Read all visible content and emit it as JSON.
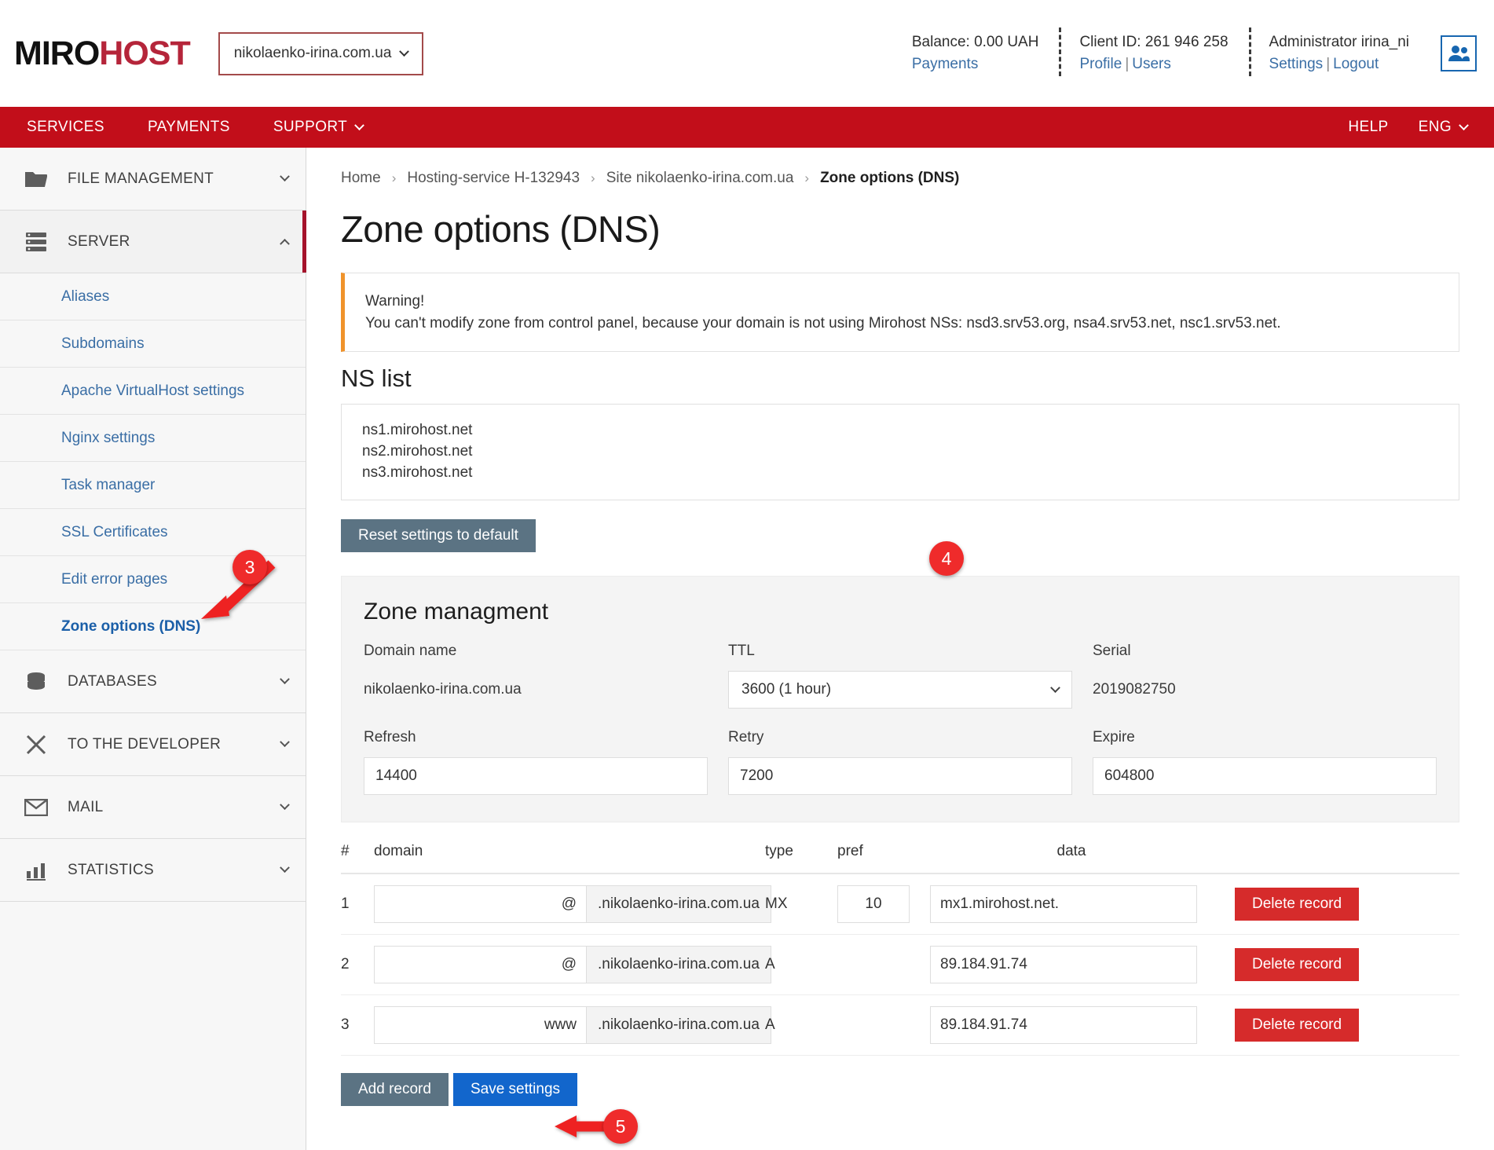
{
  "header": {
    "logo_part1": "MIRO",
    "logo_part2": "HOST",
    "domain_selector": "nikolaenko-irina.com.ua",
    "balance": "Balance: 0.00 UAH",
    "payments_link": "Payments",
    "client_id": "Client ID: 261 946 258",
    "profile_link": "Profile",
    "users_link": "Users",
    "administrator": "Administrator irina_ni",
    "settings_link": "Settings",
    "logout_link": "Logout",
    "separator": "|"
  },
  "nav": {
    "services": "SERVICES",
    "payments": "PAYMENTS",
    "support": "SUPPORT",
    "help": "HELP",
    "lang": "ENG"
  },
  "sidebar": {
    "sections": [
      {
        "label": "FILE MANAGEMENT",
        "icon": "folder-icon",
        "expanded": false
      },
      {
        "label": "SERVER",
        "icon": "server-icon",
        "expanded": true
      },
      {
        "label": "DATABASES",
        "icon": "database-icon",
        "expanded": false
      },
      {
        "label": "TO THE DEVELOPER",
        "icon": "tools-icon",
        "expanded": false
      },
      {
        "label": "MAIL",
        "icon": "envelope-icon",
        "expanded": false
      },
      {
        "label": "STATISTICS",
        "icon": "chart-icon",
        "expanded": false
      }
    ],
    "server_items": [
      "Aliases",
      "Subdomains",
      "Apache VirtualHost settings",
      "Nginx settings",
      "Task manager",
      "SSL Certificates",
      "Edit error pages",
      "Zone options (DNS)"
    ]
  },
  "breadcrumb": {
    "items": [
      "Home",
      "Hosting-service H-132943",
      "Site nikolaenko-irina.com.ua",
      "Zone options (DNS)"
    ],
    "separator": "›"
  },
  "page": {
    "title": "Zone options (DNS)",
    "warning_title": "Warning!",
    "warning_text": "You can't modify zone from control panel, because your domain is not using Mirohost NSs: nsd3.srv53.org, nsa4.srv53.net, nsc1.srv53.net.",
    "ns_list_heading": "NS list",
    "ns_list": [
      "ns1.mirohost.net",
      "ns2.mirohost.net",
      "ns3.mirohost.net"
    ],
    "reset_button": "Reset settings to default"
  },
  "zone": {
    "title": "Zone managment",
    "domain_name_label": "Domain name",
    "domain_name_value": "nikolaenko-irina.com.ua",
    "ttl_label": "TTL",
    "ttl_value": "3600 (1 hour)",
    "serial_label": "Serial",
    "serial_value": "2019082750",
    "refresh_label": "Refresh",
    "refresh_value": "14400",
    "retry_label": "Retry",
    "retry_value": "7200",
    "expire_label": "Expire",
    "expire_value": "604800"
  },
  "records": {
    "columns": [
      "#",
      "domain",
      "type",
      "pref",
      "data"
    ],
    "domain_suffix": ".nikolaenko-irina.com.ua",
    "delete_label": "Delete record",
    "rows": [
      {
        "num": "1",
        "domain": "@",
        "type": "MX",
        "pref": "10",
        "data": "mx1.mirohost.net."
      },
      {
        "num": "2",
        "domain": "@",
        "type": "A",
        "pref": "",
        "data": "89.184.91.74"
      },
      {
        "num": "3",
        "domain": "www",
        "type": "A",
        "pref": "",
        "data": "89.184.91.74"
      }
    ],
    "add_record": "Add record",
    "save_settings": "Save settings"
  },
  "annotations": {
    "marker3": "3",
    "marker4": "4",
    "marker5": "5"
  },
  "colors": {
    "brand_red": "#c20e1a",
    "logo_red": "#b5253a",
    "link_blue": "#3a6ea5",
    "warning_orange": "#f0932b",
    "slate": "#5b7383",
    "primary_blue": "#1266cc",
    "danger_red": "#d62b2b",
    "annotation_red": "#ef2b2b"
  }
}
